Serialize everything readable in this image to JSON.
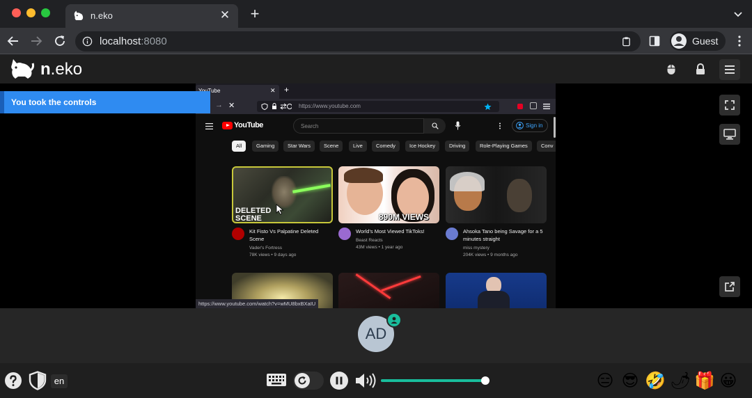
{
  "browser": {
    "tab_title": "n.eko",
    "url_host": "localhost",
    "url_port": ":8080",
    "profile_label": "Guest"
  },
  "app": {
    "logo_bold": "n",
    "logo_rest": ".eko",
    "notice": "You took the controls",
    "user_initials": "AD",
    "language": "en",
    "volume_percent": 100
  },
  "remote": {
    "tab_title": "YouTube",
    "url": "https://www.youtube.com",
    "search_placeholder": "Search",
    "sign_in": "Sign in",
    "logo_text": "YouTube",
    "chips": [
      "All",
      "Gaming",
      "Star Wars",
      "Scene",
      "Live",
      "Comedy",
      "Ice Hockey",
      "Driving",
      "Role-Playing Games",
      "Conv"
    ],
    "videos": [
      {
        "title": "Kit Fisto Vs Palpatine Deleted Scene",
        "channel": "Vader's Fortress",
        "meta": "78K views • 9 days ago",
        "thumb_text": "DELETED SCENE"
      },
      {
        "title": "World's Most Viewed TikToks!",
        "channel": "Beast Reacts",
        "meta": "43M views • 1 year ago",
        "thumb_text": "890M VIEWS"
      },
      {
        "title": "Ahsoka Tano being Savage for a 5 minutes straight",
        "channel": "miss mystery",
        "meta": "204K views • 9 months ago",
        "thumb_text": ""
      }
    ],
    "status_url": "https://www.youtube.com/watch?v=wMU8bxBXaIU"
  },
  "colors": {
    "accent": "#2f8bf1",
    "volume": "#19bd9c",
    "yt_red": "#ff0000"
  }
}
